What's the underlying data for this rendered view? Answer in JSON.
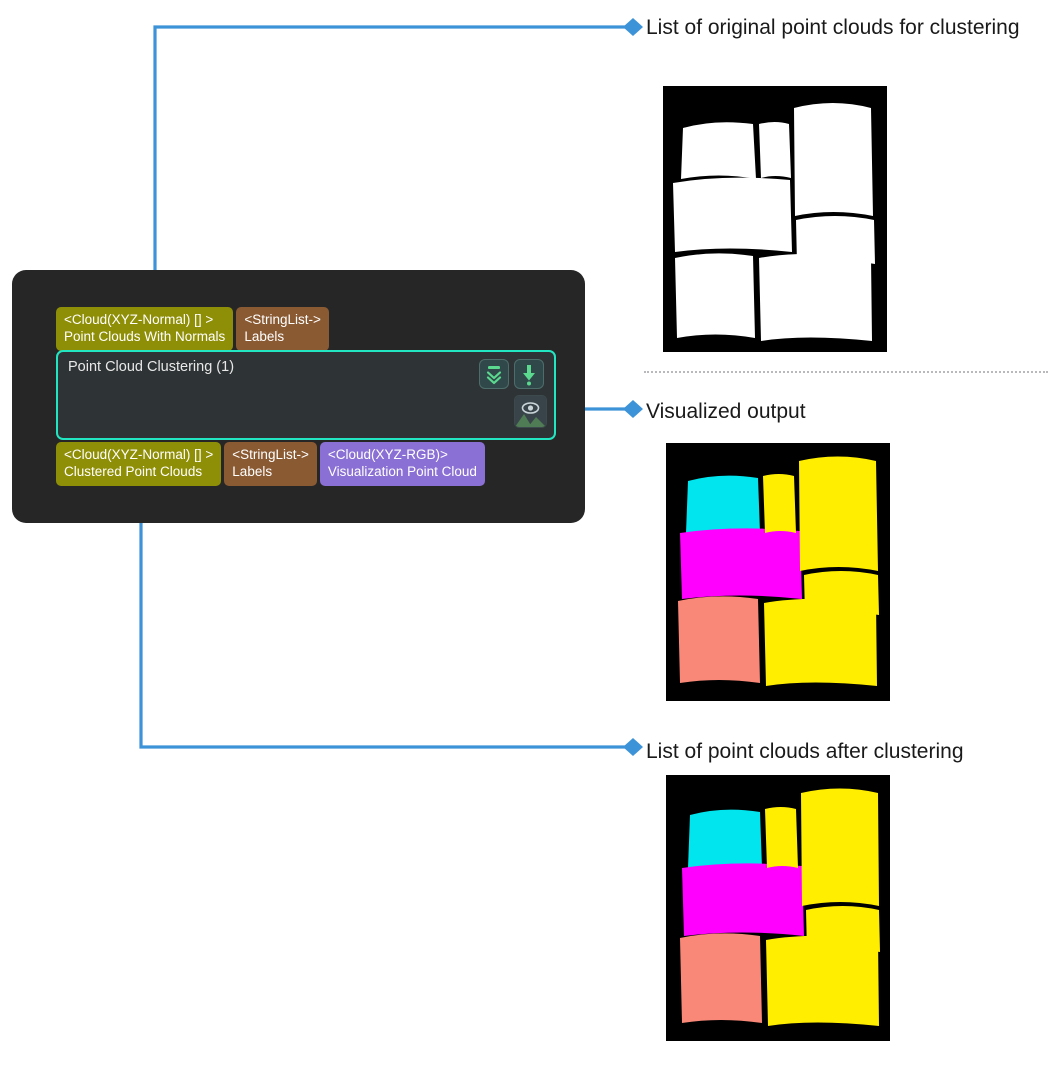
{
  "node": {
    "title": "Point Cloud Clustering (1)",
    "selected_outline_color": "#21e6c1",
    "panel_bg": "#262626",
    "body_bg": "#2e3436",
    "inputs": [
      {
        "type": "<Cloud(XYZ-Normal) [] >",
        "name": "Point Clouds With Normals",
        "color": "#8f8f07",
        "icon": "port-connector-diamond"
      },
      {
        "type": "<StringList->",
        "name": "Labels",
        "color": "#8a5a33"
      }
    ],
    "outputs": [
      {
        "type": "<Cloud(XYZ-Normal) [] >",
        "name": "Clustered Point Clouds",
        "color": "#8f8f07",
        "icon": "port-connector-diamond"
      },
      {
        "type": "<StringList->",
        "name": "Labels",
        "color": "#8a5a33"
      },
      {
        "type": "<Cloud(XYZ-RGB)>",
        "name": "Visualization Point Cloud",
        "color": "#8a6fd4"
      }
    ],
    "buttons": [
      {
        "id": "collapse",
        "icon": "collapse-chevrons-down-icon",
        "accent": "#5ad98f"
      },
      {
        "id": "download",
        "icon": "download-arrow-down-icon",
        "accent": "#5ad98f"
      },
      {
        "id": "preview",
        "icon": "image-preview-eye-icon",
        "accent": "#7a8b91"
      }
    ]
  },
  "annotations": [
    {
      "id": "annot-1",
      "text": "List of original point clouds for clustering",
      "marker": "diamond-marker",
      "marker_color": "#3d93d8"
    },
    {
      "id": "annot-2",
      "text": "Visualized output",
      "marker": "diamond-marker",
      "marker_color": "#3d93d8"
    },
    {
      "id": "annot-3",
      "text": "List of point clouds after clustering",
      "marker": "diamond-marker",
      "marker_color": "#3d93d8"
    }
  ],
  "images": [
    {
      "id": "pc-original",
      "caption_ref": "annot-1",
      "background": "#000000",
      "cluster_colors": [
        "#ffffff"
      ]
    },
    {
      "id": "pc-visualized",
      "caption_ref": "annot-2",
      "background": "#000000",
      "cluster_colors": [
        "#00e5ee",
        "#ff00ff",
        "#f98878",
        "#ffee00"
      ]
    },
    {
      "id": "pc-clustered",
      "caption_ref": "annot-3",
      "background": "#000000",
      "cluster_colors": [
        "#00e5ee",
        "#ff00ff",
        "#f98878",
        "#ffee00"
      ]
    }
  ],
  "connector_color": "#3d93d8"
}
